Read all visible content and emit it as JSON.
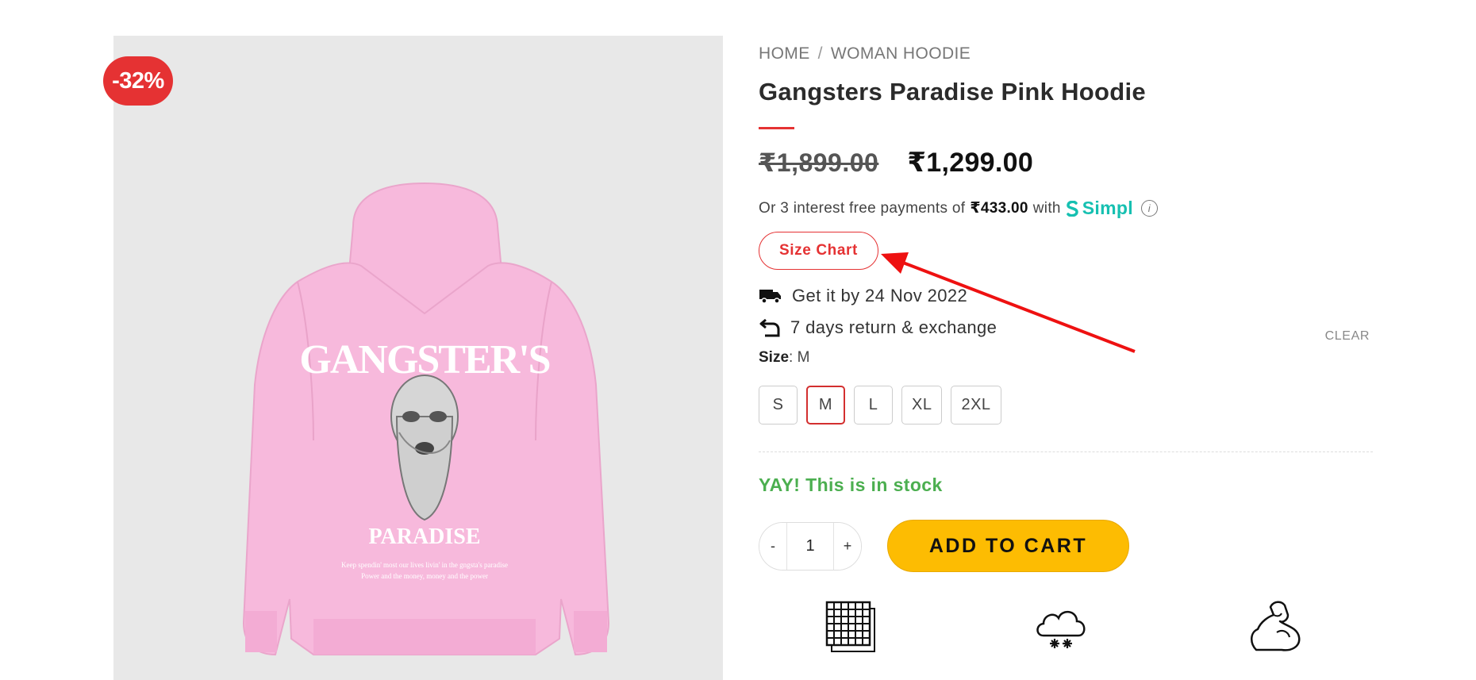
{
  "badge": {
    "discount": "-32%"
  },
  "product_image": {
    "print_title": "GANGSTER'S",
    "print_subtitle": "PARADISE",
    "print_line1": "Keep spendin' most our lives livin' in the gngsta's paradise",
    "print_line2": "Power and the money, money and the power"
  },
  "breadcrumb": {
    "home": "HOME",
    "separator": "/",
    "category": "WOMAN HOODIE"
  },
  "product": {
    "title": "Gangsters Paradise Pink Hoodie",
    "old_price": "₹1,899.00",
    "new_price": "₹1,299.00"
  },
  "emi": {
    "prefix": "Or 3 interest free payments of",
    "amount": "₹433.00",
    "with": "with",
    "brand": "Simpl",
    "info": "i"
  },
  "size_chart": {
    "label": "Size Chart"
  },
  "perks": {
    "delivery": "Get it by 24 Nov 2022",
    "returns": "7 days return & exchange"
  },
  "size": {
    "label": "Size",
    "selected": "M",
    "clear": "CLEAR",
    "options": [
      "S",
      "M",
      "L",
      "XL",
      "2XL"
    ]
  },
  "stock": {
    "message": "YAY! This is in stock"
  },
  "cart": {
    "minus": "-",
    "quantity": "1",
    "plus": "+",
    "add_label": "ADD TO CART"
  },
  "colors": {
    "accent_red": "#e53233",
    "cart_yellow": "#fdbc02",
    "stock_green": "#4caf50",
    "simpl_teal": "#16c0b1",
    "hoodie_pink": "#f7b9dc"
  },
  "icons": [
    "delivery-truck-icon",
    "return-arrow-icon",
    "fabric-mesh-icon",
    "cloud-snow-icon",
    "flexed-arm-icon"
  ]
}
